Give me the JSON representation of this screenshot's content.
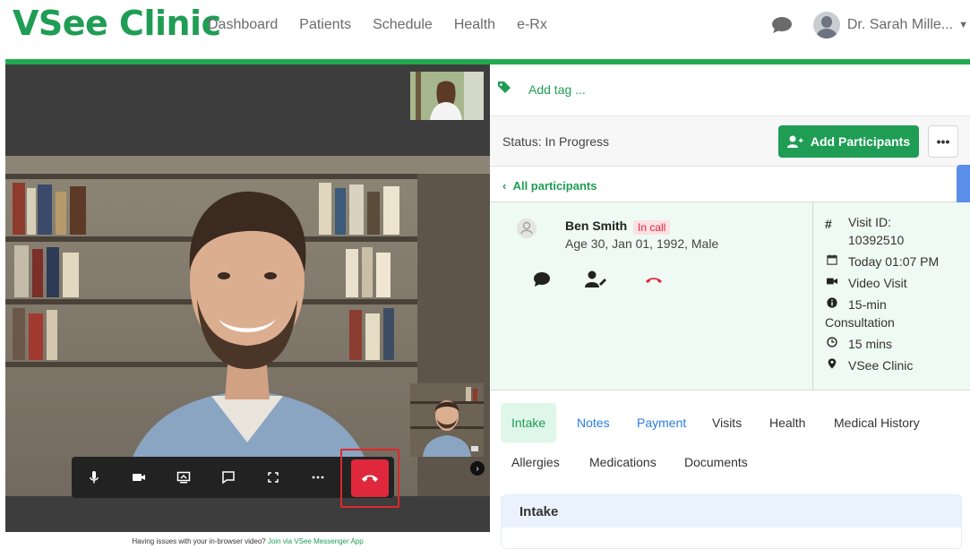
{
  "app": {
    "logo": "VSee Clinic",
    "nav": [
      "Dashboard",
      "Patients",
      "Schedule",
      "Health",
      "e-Rx"
    ],
    "user_name": "Dr. Sarah Mille...",
    "brand_color": "#1f9d55",
    "hangup_color": "#e0283c"
  },
  "video": {
    "footer_text": "Having issues with your in-browser video?",
    "footer_link": "Join via VSee Messenger App",
    "controls": [
      "microphone-icon",
      "camera-icon",
      "screen-share-icon",
      "chat-icon",
      "fullscreen-icon",
      "more-icon"
    ]
  },
  "panel": {
    "tag_label": "Add tag ...",
    "status": "Status: In Progress",
    "add_participants": "Add Participants",
    "more": "•••",
    "all_participants": "All participants",
    "patient": {
      "name": "Ben Smith",
      "badge": "In call",
      "info": "Age 30, Jan 01, 1992, Male"
    },
    "visit": {
      "id_label": "Visit ID:",
      "id_value": "10392510",
      "time": "Today 01:07 PM",
      "type": "Video Visit",
      "reason_a": "15-min",
      "reason_b": "Consultation",
      "duration": "15 mins",
      "clinic": "VSee Clinic"
    },
    "tabs": [
      {
        "label": "Intake"
      },
      {
        "label": "Notes"
      },
      {
        "label": "Payment"
      },
      {
        "label": "Visits"
      },
      {
        "label": "Health"
      },
      {
        "label": "Medical History"
      },
      {
        "label": "Allergies"
      },
      {
        "label": "Medications"
      },
      {
        "label": "Documents"
      }
    ],
    "intake_title": "Intake"
  }
}
